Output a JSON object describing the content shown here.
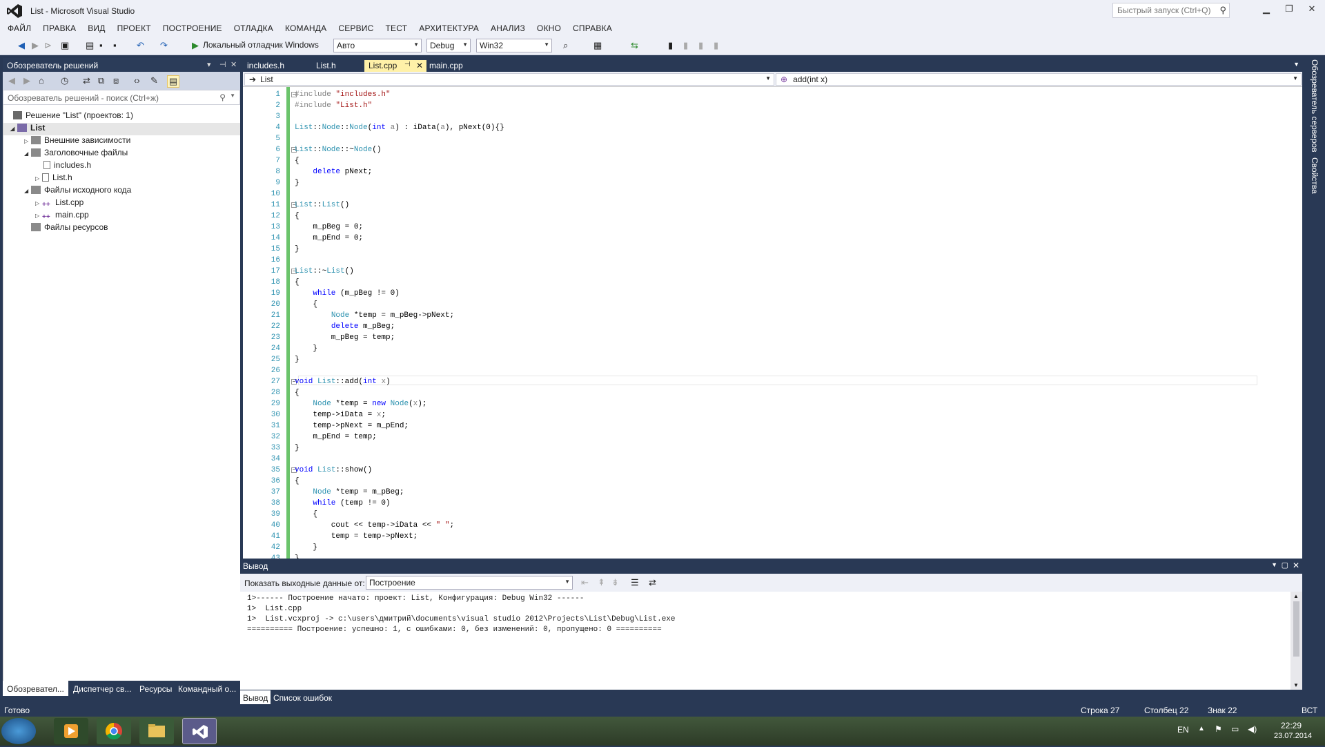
{
  "window": {
    "title": "List - Microsoft Visual Studio",
    "quick_launch_placeholder": "Быстрый запуск (Ctrl+Q)"
  },
  "menu": [
    "ФАЙЛ",
    "ПРАВКА",
    "ВИД",
    "ПРОЕКТ",
    "ПОСТРОЕНИЕ",
    "ОТЛАДКА",
    "КОМАНДА",
    "СЕРВИС",
    "ТЕСТ",
    "АРХИТЕКТУРА",
    "АНАЛИЗ",
    "ОКНО",
    "СПРАВКА"
  ],
  "toolbar": {
    "debug_target": "Локальный отладчик Windows",
    "cfg_auto": "Авто",
    "configuration": "Debug",
    "platform": "Win32"
  },
  "solution_explorer": {
    "title": "Обозреватель решений",
    "search_placeholder": "Обозреватель решений - поиск (Ctrl+ж)",
    "items": [
      {
        "label": "Решение \"List\" (проектов: 1)"
      },
      {
        "label": "List"
      },
      {
        "label": "Внешние зависимости"
      },
      {
        "label": "Заголовочные файлы"
      },
      {
        "label": "includes.h"
      },
      {
        "label": "List.h"
      },
      {
        "label": "Файлы исходного кода"
      },
      {
        "label": "List.cpp"
      },
      {
        "label": "main.cpp"
      },
      {
        "label": "Файлы ресурсов"
      }
    ],
    "tabs": [
      "Обозревател...",
      "Диспетчер св...",
      "Ресурсы",
      "Командный о..."
    ]
  },
  "editor": {
    "tabs": [
      "includes.h",
      "List.h",
      "List.cpp",
      "main.cpp"
    ],
    "nav_left": "List",
    "nav_right": "add(int x)"
  },
  "code_lines": [
    "#include \"includes.h\"",
    "#include \"List.h\"",
    "",
    "List::Node::Node(int a) : iData(a), pNext(0){}",
    "",
    "List::Node::~Node()",
    "{",
    "    delete pNext;",
    "}",
    "",
    "List::List()",
    "{",
    "    m_pBeg = 0;",
    "    m_pEnd = 0;",
    "}",
    "",
    "List::~List()",
    "{",
    "    while (m_pBeg != 0)",
    "    {",
    "        Node *temp = m_pBeg->pNext;",
    "        delete m_pBeg;",
    "        m_pBeg = temp;",
    "    }",
    "}",
    "",
    "void List::add(int x)",
    "{",
    "    Node *temp = new Node(x);",
    "    temp->iData = x;",
    "    temp->pNext = m_pEnd;",
    "    m_pEnd = temp;",
    "}",
    "",
    "void List::show()",
    "{",
    "    Node *temp = m_pBeg;",
    "    while (temp != 0)",
    "    {",
    "        cout << temp->iData << \" \";",
    "        temp = temp->pNext;",
    "    }",
    "}"
  ],
  "output": {
    "title": "Вывод",
    "show_from_label": "Показать выходные данные от:",
    "show_from_value": "Построение",
    "lines": [
      "1>------ Построение начато: проект: List, Конфигурация: Debug Win32 ------",
      "1>  List.cpp",
      "1>  List.vcxproj -> c:\\users\\дмитрий\\documents\\visual studio 2012\\Projects\\List\\Debug\\List.exe",
      "========== Построение: успешно: 1, с ошибками: 0, без изменений: 0, пропущено: 0 =========="
    ],
    "tabs": [
      "Вывод",
      "Список ошибок"
    ]
  },
  "right_rail": [
    "Обозреватель серверов",
    "Свойства"
  ],
  "status": {
    "ready": "Готово",
    "line": "Строка 27",
    "col": "Столбец 22",
    "char": "Знак 22",
    "mode": "ВСТ"
  },
  "taskbar": {
    "lang": "EN",
    "time": "22:29",
    "date": "23.07.2014"
  }
}
